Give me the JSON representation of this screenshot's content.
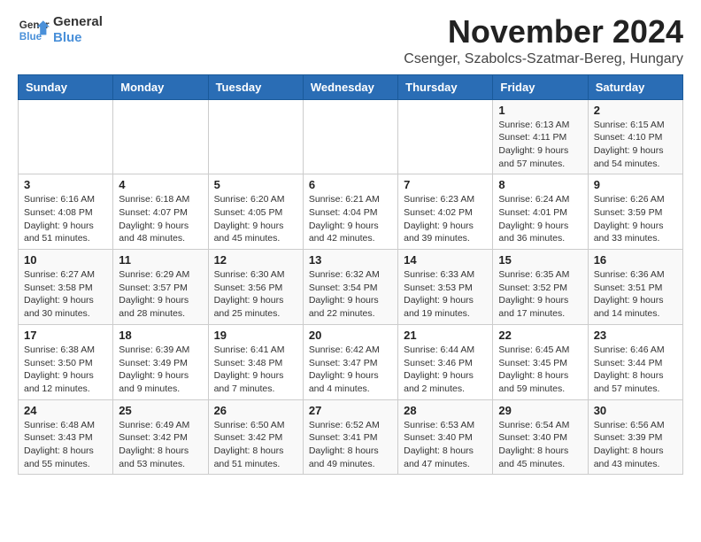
{
  "logo": {
    "text_general": "General",
    "text_blue": "Blue",
    "icon_color": "#4a90d9"
  },
  "header": {
    "title": "November 2024",
    "subtitle": "Csenger, Szabolcs-Szatmar-Bereg, Hungary"
  },
  "calendar": {
    "days_of_week": [
      "Sunday",
      "Monday",
      "Tuesday",
      "Wednesday",
      "Thursday",
      "Friday",
      "Saturday"
    ],
    "weeks": [
      [
        {
          "day": "",
          "info": ""
        },
        {
          "day": "",
          "info": ""
        },
        {
          "day": "",
          "info": ""
        },
        {
          "day": "",
          "info": ""
        },
        {
          "day": "",
          "info": ""
        },
        {
          "day": "1",
          "info": "Sunrise: 6:13 AM\nSunset: 4:11 PM\nDaylight: 9 hours and 57 minutes."
        },
        {
          "day": "2",
          "info": "Sunrise: 6:15 AM\nSunset: 4:10 PM\nDaylight: 9 hours and 54 minutes."
        }
      ],
      [
        {
          "day": "3",
          "info": "Sunrise: 6:16 AM\nSunset: 4:08 PM\nDaylight: 9 hours and 51 minutes."
        },
        {
          "day": "4",
          "info": "Sunrise: 6:18 AM\nSunset: 4:07 PM\nDaylight: 9 hours and 48 minutes."
        },
        {
          "day": "5",
          "info": "Sunrise: 6:20 AM\nSunset: 4:05 PM\nDaylight: 9 hours and 45 minutes."
        },
        {
          "day": "6",
          "info": "Sunrise: 6:21 AM\nSunset: 4:04 PM\nDaylight: 9 hours and 42 minutes."
        },
        {
          "day": "7",
          "info": "Sunrise: 6:23 AM\nSunset: 4:02 PM\nDaylight: 9 hours and 39 minutes."
        },
        {
          "day": "8",
          "info": "Sunrise: 6:24 AM\nSunset: 4:01 PM\nDaylight: 9 hours and 36 minutes."
        },
        {
          "day": "9",
          "info": "Sunrise: 6:26 AM\nSunset: 3:59 PM\nDaylight: 9 hours and 33 minutes."
        }
      ],
      [
        {
          "day": "10",
          "info": "Sunrise: 6:27 AM\nSunset: 3:58 PM\nDaylight: 9 hours and 30 minutes."
        },
        {
          "day": "11",
          "info": "Sunrise: 6:29 AM\nSunset: 3:57 PM\nDaylight: 9 hours and 28 minutes."
        },
        {
          "day": "12",
          "info": "Sunrise: 6:30 AM\nSunset: 3:56 PM\nDaylight: 9 hours and 25 minutes."
        },
        {
          "day": "13",
          "info": "Sunrise: 6:32 AM\nSunset: 3:54 PM\nDaylight: 9 hours and 22 minutes."
        },
        {
          "day": "14",
          "info": "Sunrise: 6:33 AM\nSunset: 3:53 PM\nDaylight: 9 hours and 19 minutes."
        },
        {
          "day": "15",
          "info": "Sunrise: 6:35 AM\nSunset: 3:52 PM\nDaylight: 9 hours and 17 minutes."
        },
        {
          "day": "16",
          "info": "Sunrise: 6:36 AM\nSunset: 3:51 PM\nDaylight: 9 hours and 14 minutes."
        }
      ],
      [
        {
          "day": "17",
          "info": "Sunrise: 6:38 AM\nSunset: 3:50 PM\nDaylight: 9 hours and 12 minutes."
        },
        {
          "day": "18",
          "info": "Sunrise: 6:39 AM\nSunset: 3:49 PM\nDaylight: 9 hours and 9 minutes."
        },
        {
          "day": "19",
          "info": "Sunrise: 6:41 AM\nSunset: 3:48 PM\nDaylight: 9 hours and 7 minutes."
        },
        {
          "day": "20",
          "info": "Sunrise: 6:42 AM\nSunset: 3:47 PM\nDaylight: 9 hours and 4 minutes."
        },
        {
          "day": "21",
          "info": "Sunrise: 6:44 AM\nSunset: 3:46 PM\nDaylight: 9 hours and 2 minutes."
        },
        {
          "day": "22",
          "info": "Sunrise: 6:45 AM\nSunset: 3:45 PM\nDaylight: 8 hours and 59 minutes."
        },
        {
          "day": "23",
          "info": "Sunrise: 6:46 AM\nSunset: 3:44 PM\nDaylight: 8 hours and 57 minutes."
        }
      ],
      [
        {
          "day": "24",
          "info": "Sunrise: 6:48 AM\nSunset: 3:43 PM\nDaylight: 8 hours and 55 minutes."
        },
        {
          "day": "25",
          "info": "Sunrise: 6:49 AM\nSunset: 3:42 PM\nDaylight: 8 hours and 53 minutes."
        },
        {
          "day": "26",
          "info": "Sunrise: 6:50 AM\nSunset: 3:42 PM\nDaylight: 8 hours and 51 minutes."
        },
        {
          "day": "27",
          "info": "Sunrise: 6:52 AM\nSunset: 3:41 PM\nDaylight: 8 hours and 49 minutes."
        },
        {
          "day": "28",
          "info": "Sunrise: 6:53 AM\nSunset: 3:40 PM\nDaylight: 8 hours and 47 minutes."
        },
        {
          "day": "29",
          "info": "Sunrise: 6:54 AM\nSunset: 3:40 PM\nDaylight: 8 hours and 45 minutes."
        },
        {
          "day": "30",
          "info": "Sunrise: 6:56 AM\nSunset: 3:39 PM\nDaylight: 8 hours and 43 minutes."
        }
      ]
    ]
  }
}
